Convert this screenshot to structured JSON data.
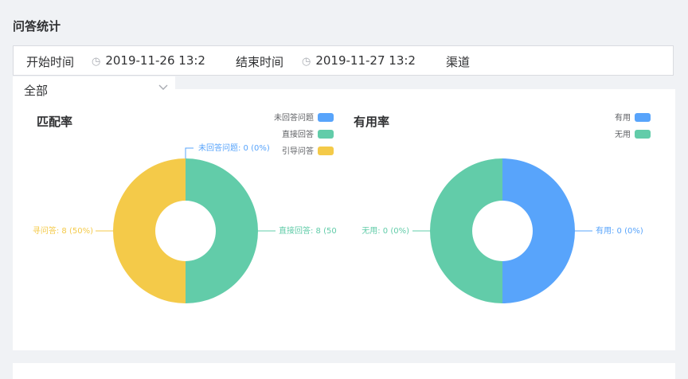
{
  "page": {
    "title": "问答统计"
  },
  "filters": {
    "start_label": "开始时间",
    "start_value": "2019-11-26 13:2",
    "end_label": "结束时间",
    "end_value": "2019-11-27 13:2",
    "channel_label": "渠道",
    "channel_value": "全部"
  },
  "colors": {
    "blue": "#58a4fb",
    "green": "#62cca9",
    "yellow": "#f4ca49"
  },
  "chart_data": [
    {
      "type": "pie",
      "title": "匹配率",
      "legend_position": "top-right",
      "categories": [
        "未回答问题",
        "直接回答",
        "引导问答"
      ],
      "values": [
        0,
        8,
        8
      ],
      "percents": [
        0,
        50,
        50
      ],
      "labels": [
        "未回答问题: 0 (0%)",
        "直接回答: 8 (50",
        "寻问答: 8 (50%)"
      ]
    },
    {
      "type": "pie",
      "title": "有用率",
      "legend_position": "top-right",
      "categories": [
        "有用",
        "无用"
      ],
      "values": [
        0,
        0
      ],
      "percents": [
        0,
        0
      ],
      "labels": [
        "有用: 0 (0%)",
        "无用: 0 (0%)"
      ]
    }
  ]
}
